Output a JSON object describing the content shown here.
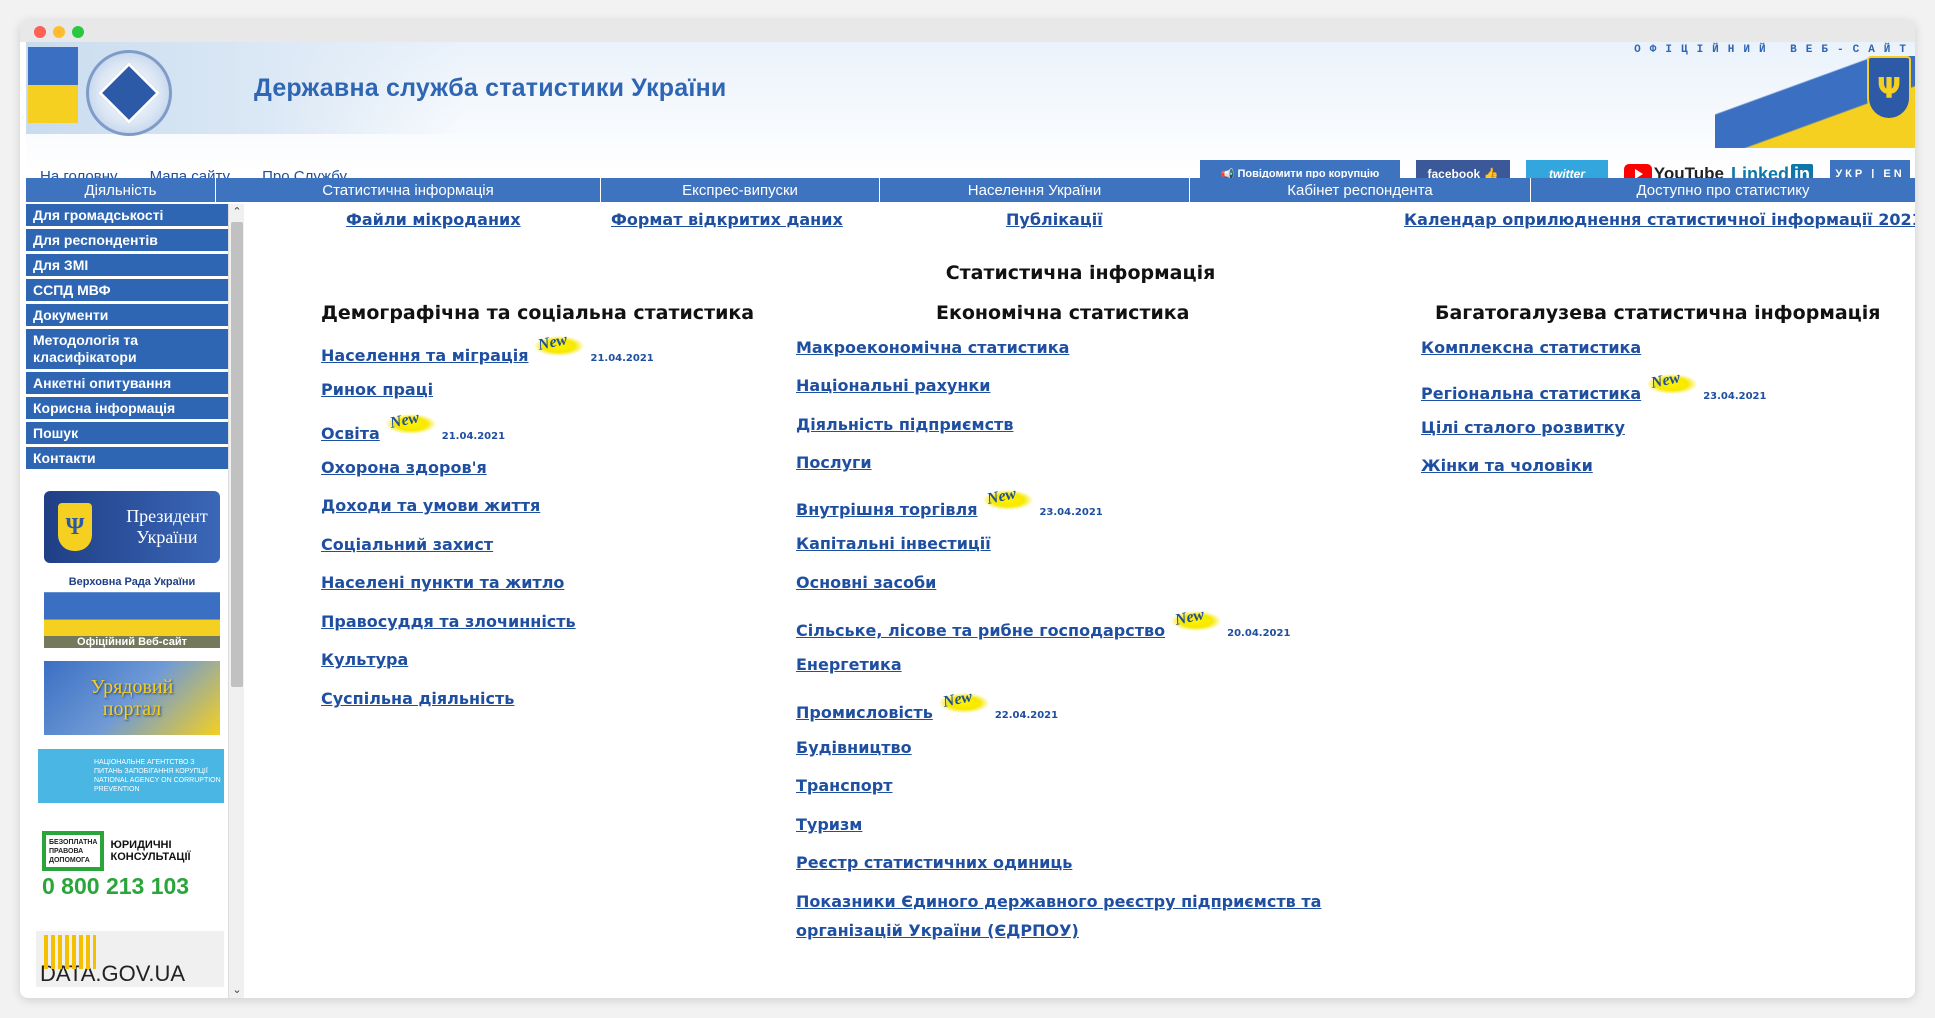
{
  "header": {
    "site_title": "Державна служба статистики України",
    "official_label": "ОФІЦІЙНИЙ ВЕБ-САЙТ",
    "top_links": [
      "На головну",
      "Мапа сайту",
      "Про Службу"
    ],
    "corruption_label": "Повідомити про корупцію",
    "facebook": "facebook",
    "twitter": "twitter",
    "youtube": "YouTube",
    "linkedin": "Linked",
    "linkedin_in": "in",
    "lang": "УКР | EN"
  },
  "main_nav": [
    "Діяльність",
    "Статистична інформація",
    "Експрес-випуски",
    "Населення України",
    "Кабінет респондента",
    "Доступно про статистику"
  ],
  "sidebar": {
    "items": [
      "Для громадськості",
      "Для респондентів",
      "Для ЗМІ",
      "ССПД МВФ",
      "Документи",
      "Методологія та класифікатори",
      "Анкетні опитування",
      "Корисна інформація",
      "Пошук",
      "Контакти"
    ],
    "banners": {
      "president": "Президент України",
      "rada_top": "Верховна Рада України",
      "rada_bottom": "Офіційний Веб-сайт",
      "gov_portal": "Урядовий портал",
      "nazk": "НАЦІОНАЛЬНЕ АГЕНТСТВО З ПИТАНЬ ЗАПОБІГАННЯ КОРУПЦІЇ NATIONAL AGENCY ON CORRUPTION PREVENTION",
      "legal_frame": "БЕЗОПЛАТНА ПРАВОВА ДОПОМОГА",
      "legal_consult": "ЮРИДИЧНІ КОНСУЛЬТАЦІЇ",
      "legal_phone": "0 800 213 103",
      "datagov": "DATA.GOV.UA"
    }
  },
  "quick_links": [
    "Файли мікроданих",
    "Формат відкритих даних",
    "Публікації",
    "Календар оприлюднення статистичної інформації 2021"
  ],
  "section_title": "Статистична інформація",
  "new_label": "New",
  "columns": [
    {
      "title": "Демографічна та соціальна статистика",
      "links": [
        {
          "label": "Населення та міграція",
          "date": "21.04.2021"
        },
        {
          "label": "Ринок праці",
          "date": ""
        },
        {
          "label": "Освіта",
          "date": "21.04.2021"
        },
        {
          "label": "Охорона здоров'я",
          "date": ""
        },
        {
          "label": "Доходи та умови життя",
          "date": ""
        },
        {
          "label": "Соціальний захист",
          "date": ""
        },
        {
          "label": "Населені пункти та житло",
          "date": ""
        },
        {
          "label": "Правосуддя та злочинність",
          "date": ""
        },
        {
          "label": "Культура",
          "date": ""
        },
        {
          "label": "Суспільна діяльність",
          "date": ""
        }
      ]
    },
    {
      "title": "Економічна статистика",
      "links": [
        {
          "label": "Макроекономічна статистика",
          "date": ""
        },
        {
          "label": "Національні рахунки",
          "date": ""
        },
        {
          "label": "Діяльність підприємств",
          "date": ""
        },
        {
          "label": "Послуги",
          "date": ""
        },
        {
          "label": "Внутрішня торгівля",
          "date": "23.04.2021"
        },
        {
          "label": "Капітальні інвестиції",
          "date": ""
        },
        {
          "label": "Основні засоби",
          "date": ""
        },
        {
          "label": "Сільське, лісове та рибне господарство",
          "date": "20.04.2021"
        },
        {
          "label": "Енергетика",
          "date": ""
        },
        {
          "label": "Промисловість",
          "date": "22.04.2021"
        },
        {
          "label": "Будівництво",
          "date": ""
        },
        {
          "label": "Транспорт",
          "date": ""
        },
        {
          "label": "Туризм",
          "date": ""
        },
        {
          "label": "Реєстр статистичних одиниць",
          "date": ""
        },
        {
          "label": "Показники Єдиного державного реєстру підприємств та",
          "date": ""
        },
        {
          "label": "організацій України (ЄДРПОУ)",
          "date": ""
        }
      ]
    },
    {
      "title": "Багатогалузева статистична інформація",
      "links": [
        {
          "label": "Комплексна статистика",
          "date": ""
        },
        {
          "label": "Регіональна статистика",
          "date": "23.04.2021"
        },
        {
          "label": "Цілі сталого розвитку",
          "date": ""
        },
        {
          "label": "Жінки та чоловіки",
          "date": ""
        }
      ]
    }
  ]
}
